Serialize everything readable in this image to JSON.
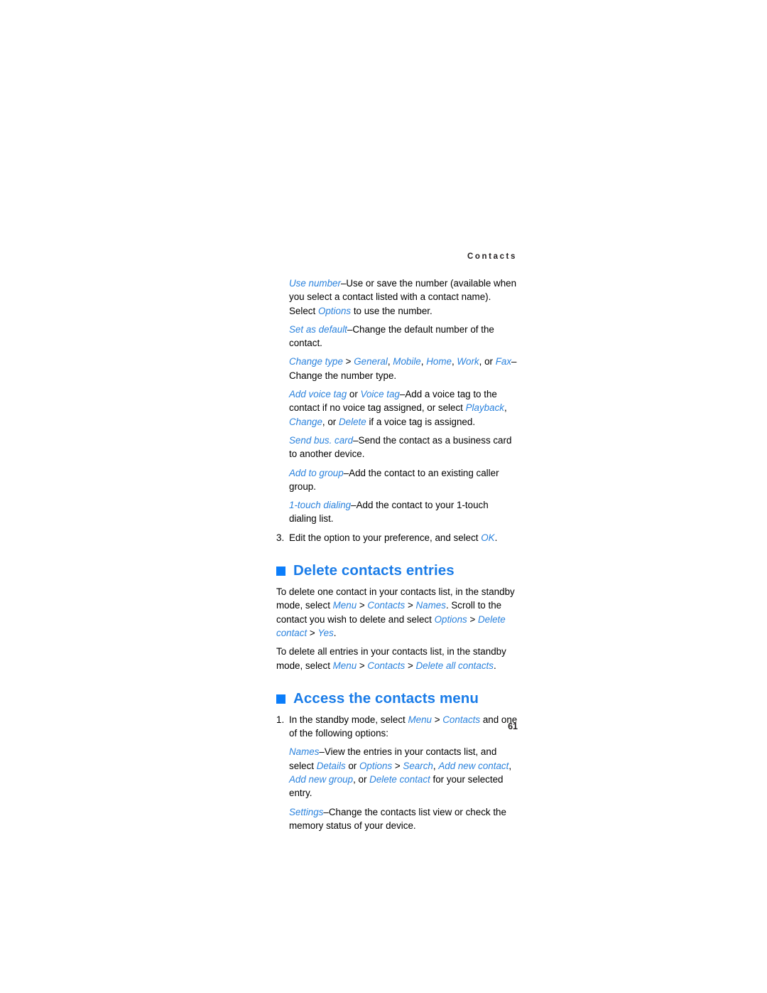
{
  "document": {
    "running_head": "Contacts",
    "page_number": "61",
    "accent_heading_color": "#1a7ce8",
    "accent_link_color": "#2a82dd",
    "bullet_color": "#0b7dfa",
    "text_color": "#000000"
  },
  "options_list": {
    "use_number": {
      "term": "Use number",
      "dash": "–",
      "text": "Use or save the number (available when you select a contact listed with a contact name). Select ",
      "term2": "Options",
      "text2": " to use the number."
    },
    "set_as_default": {
      "term": "Set as default",
      "dash": "–",
      "text": "Change the default number of the contact."
    },
    "change_type": {
      "term": "Change type",
      "sep": " > ",
      "opt1": "General",
      "opt2": "Mobile",
      "opt3": "Home",
      "opt4": "Work",
      "opt5": "Fax",
      "comma": ", ",
      "or": ", or ",
      "dash": "–",
      "text": "Change the number type."
    },
    "add_voice_tag": {
      "term": "Add voice tag",
      "or1": " or ",
      "term2": "Voice tag",
      "dash": "–",
      "text": "Add a voice tag to the contact if no voice tag assigned, or select ",
      "opt1": "Playback",
      "comma": ", ",
      "opt2": "Change",
      "text2": ", or ",
      "opt3": "Delete",
      "text3": " if a voice tag is assigned."
    },
    "send_bus_card": {
      "term": "Send bus. card",
      "dash": "–",
      "text": "Send the contact as a business card to another device."
    },
    "add_to_group": {
      "term": "Add to group",
      "dash": "–",
      "text": "Add the contact to an existing caller group."
    },
    "one_touch_dialing": {
      "term": "1-touch dialing",
      "dash": "–",
      "text": "Add the contact to your 1-touch dialing list."
    },
    "step_3": {
      "number": "3.",
      "text": "Edit the option to your preference, and select ",
      "term": "OK",
      "text2": "."
    }
  },
  "delete_section": {
    "heading": "Delete contacts entries",
    "para1": {
      "text1": "To delete one contact in your contacts list, in the standby mode, select ",
      "t1": "Menu",
      "sep1": " > ",
      "t2": "Contacts",
      "sep2": " > ",
      "t3": "Names",
      "text2": ". Scroll to the contact you wish to delete and select ",
      "t4": "Options",
      "sep3": " > ",
      "t5": "Delete contact",
      "sep4": " > ",
      "t6": "Yes",
      "text3": "."
    },
    "para2": {
      "text1": "To delete all entries in your contacts list, in the standby mode, select ",
      "t1": "Menu",
      "sep1": " > ",
      "t2": "Contacts",
      "sep2": " > ",
      "t3": "Delete all contacts",
      "text2": "."
    }
  },
  "access_section": {
    "heading": "Access the contacts menu",
    "step_1": {
      "number": "1.",
      "text1": "In the standby mode, select ",
      "t1": "Menu",
      "sep1": " > ",
      "t2": "Contacts",
      "text2": " and one of the following options:"
    },
    "names_option": {
      "term": "Names",
      "dash": "–",
      "text1": "View the entries in your contacts list, and select ",
      "t1": "Details",
      "or": " or ",
      "t2": "Options",
      "sep": " > ",
      "t3": "Search",
      "comma1": ", ",
      "t4": "Add new contact",
      "comma2": ", ",
      "t5": "Add new group",
      "text2": ", or ",
      "t6": "Delete contact",
      "text3": " for your selected entry."
    },
    "settings_option": {
      "term": "Settings",
      "dash": "–",
      "text": "Change the contacts list view or check the memory status of your device."
    }
  }
}
